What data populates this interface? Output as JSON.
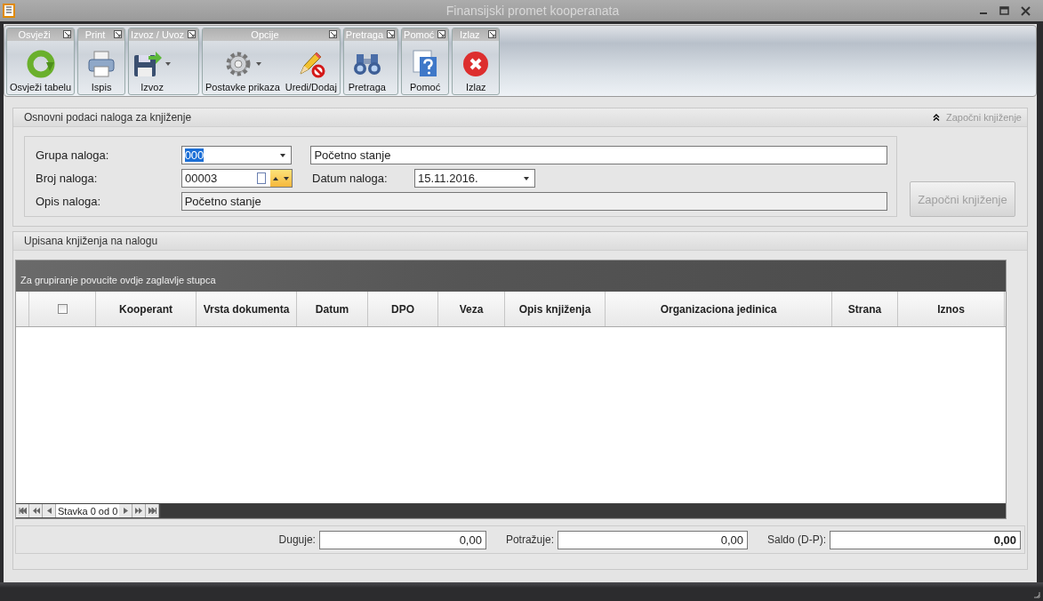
{
  "window": {
    "title": "Finansijski promet kooperanata"
  },
  "ribbon": [
    {
      "title": "Osvježi",
      "buttons": [
        {
          "label": "Osvježi tabelu",
          "dropdown": false
        }
      ]
    },
    {
      "title": "Print",
      "buttons": [
        {
          "label": "Ispis",
          "dropdown": false
        }
      ]
    },
    {
      "title": "Izvoz / Uvoz",
      "buttons": [
        {
          "label": "Izvoz",
          "dropdown": true
        }
      ]
    },
    {
      "title": "Opcije",
      "buttons": [
        {
          "label": "Postavke prikaza",
          "dropdown": true
        },
        {
          "label": "Uredi/Dodaj",
          "dropdown": false
        }
      ]
    },
    {
      "title": "Pretraga",
      "buttons": [
        {
          "label": "Pretraga",
          "dropdown": false
        }
      ]
    },
    {
      "title": "Pomoć",
      "buttons": [
        {
          "label": "Pomoć",
          "dropdown": false
        }
      ]
    },
    {
      "title": "Izlaz",
      "buttons": [
        {
          "label": "Izlaz",
          "dropdown": false
        }
      ]
    }
  ],
  "header_section": {
    "title": "Osnovni podaci naloga za knjiženje",
    "collapse_link": {
      "label": "Započni knjiženje",
      "disabled": true
    },
    "grupa": {
      "label": "Grupa naloga:",
      "value": "000",
      "text_selected": true,
      "description": "Početno stanje"
    },
    "broj": {
      "label": "Broj naloga:",
      "value": "00003"
    },
    "datum": {
      "label": "Datum naloga:",
      "value": "15.11.2016."
    },
    "opis": {
      "label": "Opis naloga:",
      "value": "Početno stanje"
    },
    "start_button": {
      "label": "Započni knjiženje",
      "disabled": true
    }
  },
  "entries_section": {
    "title": "Upisana knjiženja na nalogu",
    "group_hint": "Za grupiranje povucite ovdje zaglavlje stupca",
    "select_all": {
      "checked": false
    },
    "columns": [
      "Kooperant",
      "Vrsta dokumenta",
      "Datum",
      "DPO",
      "Veza",
      "Opis knjiženja",
      "Organizaciona jedinica",
      "Strana",
      "Iznos"
    ],
    "pager": "Stavka 0 od 0",
    "totals": [
      {
        "label": "Duguje:",
        "value": "0,00",
        "kind": "normal"
      },
      {
        "label": "Potražuje:",
        "value": "0,00",
        "kind": "normal"
      },
      {
        "label": "Saldo (D-P):",
        "value": "0,00",
        "kind": "total"
      }
    ]
  }
}
